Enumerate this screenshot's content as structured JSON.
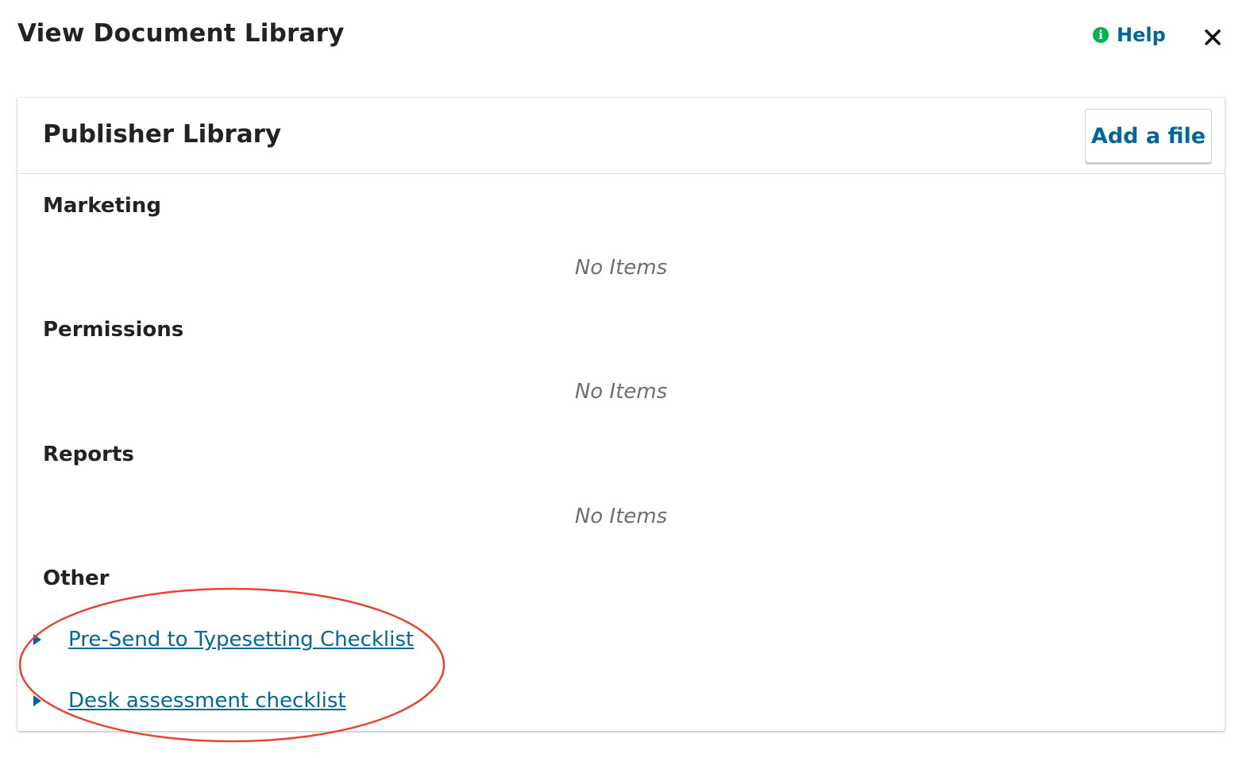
{
  "modal": {
    "title": "View Document Library",
    "help_label": "Help",
    "close_label": "×"
  },
  "library": {
    "title": "Publisher Library",
    "add_file_label": "Add a file",
    "categories": [
      {
        "name": "Marketing",
        "empty_text": "No Items"
      },
      {
        "name": "Permissions",
        "empty_text": "No Items"
      },
      {
        "name": "Reports",
        "empty_text": "No Items"
      },
      {
        "name": "Other",
        "files": [
          "Pre-Send to Typesetting Checklist",
          "Desk assessment checklist"
        ]
      }
    ]
  },
  "colors": {
    "link": "#006798",
    "help_icon": "#00b24e",
    "annotation": "#e8452c"
  },
  "icons": [
    "info-icon",
    "close-icon",
    "expand-arrow-icon"
  ]
}
